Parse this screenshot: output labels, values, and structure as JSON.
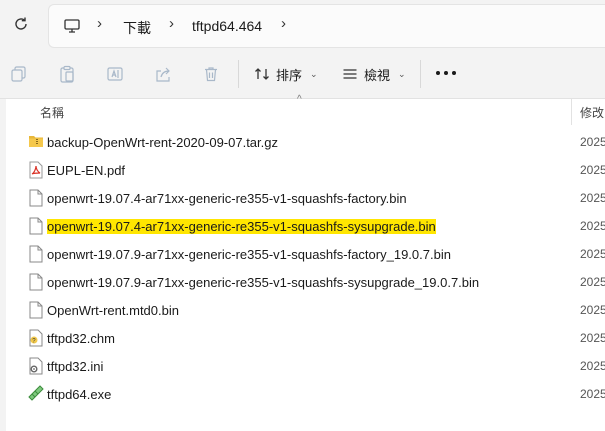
{
  "address_bar": {
    "crumbs": [
      "下載",
      "tftpd64.464"
    ],
    "separator": "›"
  },
  "toolbar": {
    "sort_label": "排序",
    "view_label": "檢視"
  },
  "columns": {
    "name": "名稱",
    "modified": "修改"
  },
  "files": [
    {
      "name": "backup-OpenWrt-rent-2020-09-07.tar.gz",
      "date": "2025",
      "icon": "archive-folder-icon"
    },
    {
      "name": "EUPL-EN.pdf",
      "date": "2025",
      "icon": "pdf-icon"
    },
    {
      "name": "openwrt-19.07.4-ar71xx-generic-re355-v1-squashfs-factory.bin",
      "date": "2025",
      "icon": "file-icon"
    },
    {
      "name": "openwrt-19.07.4-ar71xx-generic-re355-v1-squashfs-sysupgrade.bin",
      "date": "2025",
      "icon": "file-icon",
      "highlight": "#ffe600"
    },
    {
      "name": "openwrt-19.07.9-ar71xx-generic-re355-v1-squashfs-factory_19.0.7.bin",
      "date": "2025",
      "icon": "file-icon"
    },
    {
      "name": "openwrt-19.07.9-ar71xx-generic-re355-v1-squashfs-sysupgrade_19.0.7.bin",
      "date": "2025",
      "icon": "file-icon"
    },
    {
      "name": "OpenWrt-rent.mtd0.bin",
      "date": "2025",
      "icon": "file-icon"
    },
    {
      "name": "tftpd32.chm",
      "date": "2025",
      "icon": "help-file-icon"
    },
    {
      "name": "tftpd32.ini",
      "date": "2025",
      "icon": "settings-file-icon"
    },
    {
      "name": "tftpd64.exe",
      "date": "2025",
      "icon": "exe-icon"
    }
  ]
}
